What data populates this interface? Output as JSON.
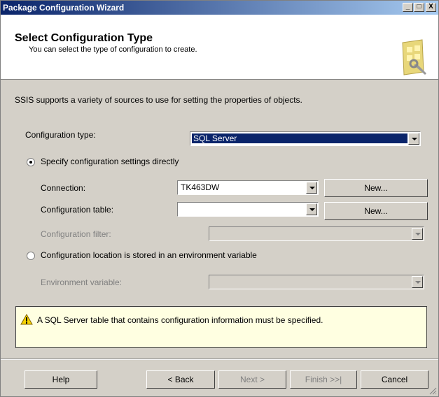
{
  "window": {
    "title": "Package Configuration Wizard",
    "min_label": "_",
    "max_label": "□",
    "close_label": "X"
  },
  "header": {
    "title": "Select Configuration Type",
    "subtitle": "You can select the type of configuration to create."
  },
  "description": "SSIS supports a variety of sources to use for setting the properties of objects.",
  "config_type": {
    "label": "Configuration type:",
    "value": "SQL Server"
  },
  "radio_direct": {
    "label": "Specify configuration settings directly",
    "selected": true
  },
  "connection": {
    "label": "Connection:",
    "value": "TK463DW",
    "new_label": "New..."
  },
  "config_table": {
    "label": "Configuration table:",
    "value": "",
    "new_label": "New..."
  },
  "config_filter": {
    "label": "Configuration filter:",
    "value": ""
  },
  "radio_env": {
    "label": "Configuration location is stored in an environment variable",
    "selected": false
  },
  "env_variable": {
    "label": "Environment variable:",
    "value": ""
  },
  "warning": {
    "text": "A SQL Server table that contains configuration information must be specified.",
    "icon": "warning-icon"
  },
  "buttons": {
    "help": "Help",
    "back": "< Back",
    "next": "Next >",
    "finish": "Finish >>|",
    "cancel": "Cancel"
  },
  "colors": {
    "title_bar": "#0a246a",
    "selection": "#0a246a",
    "warning_bg": "#ffffe1",
    "dialog_bg": "#d4d0c8"
  }
}
